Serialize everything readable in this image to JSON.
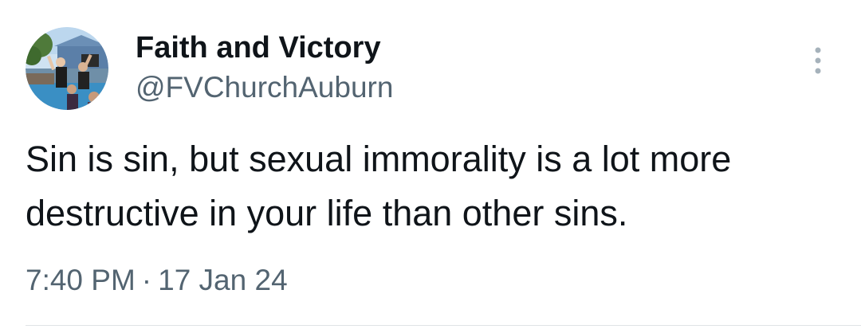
{
  "tweet": {
    "display_name": "Faith and Victory",
    "handle": "@FVChurchAuburn",
    "text": "Sin is sin, but sexual immorality is a lot more\ndestructive in your life than other sins.",
    "time": "7:40 PM",
    "separator": "·",
    "date": "17 Jan 24"
  },
  "icons": {
    "more": "more-vertical-icon",
    "avatar": "profile-photo-icon"
  },
  "colors": {
    "primary_text": "#0f1419",
    "secondary_text": "#536471",
    "divider": "#dfe3e6"
  }
}
